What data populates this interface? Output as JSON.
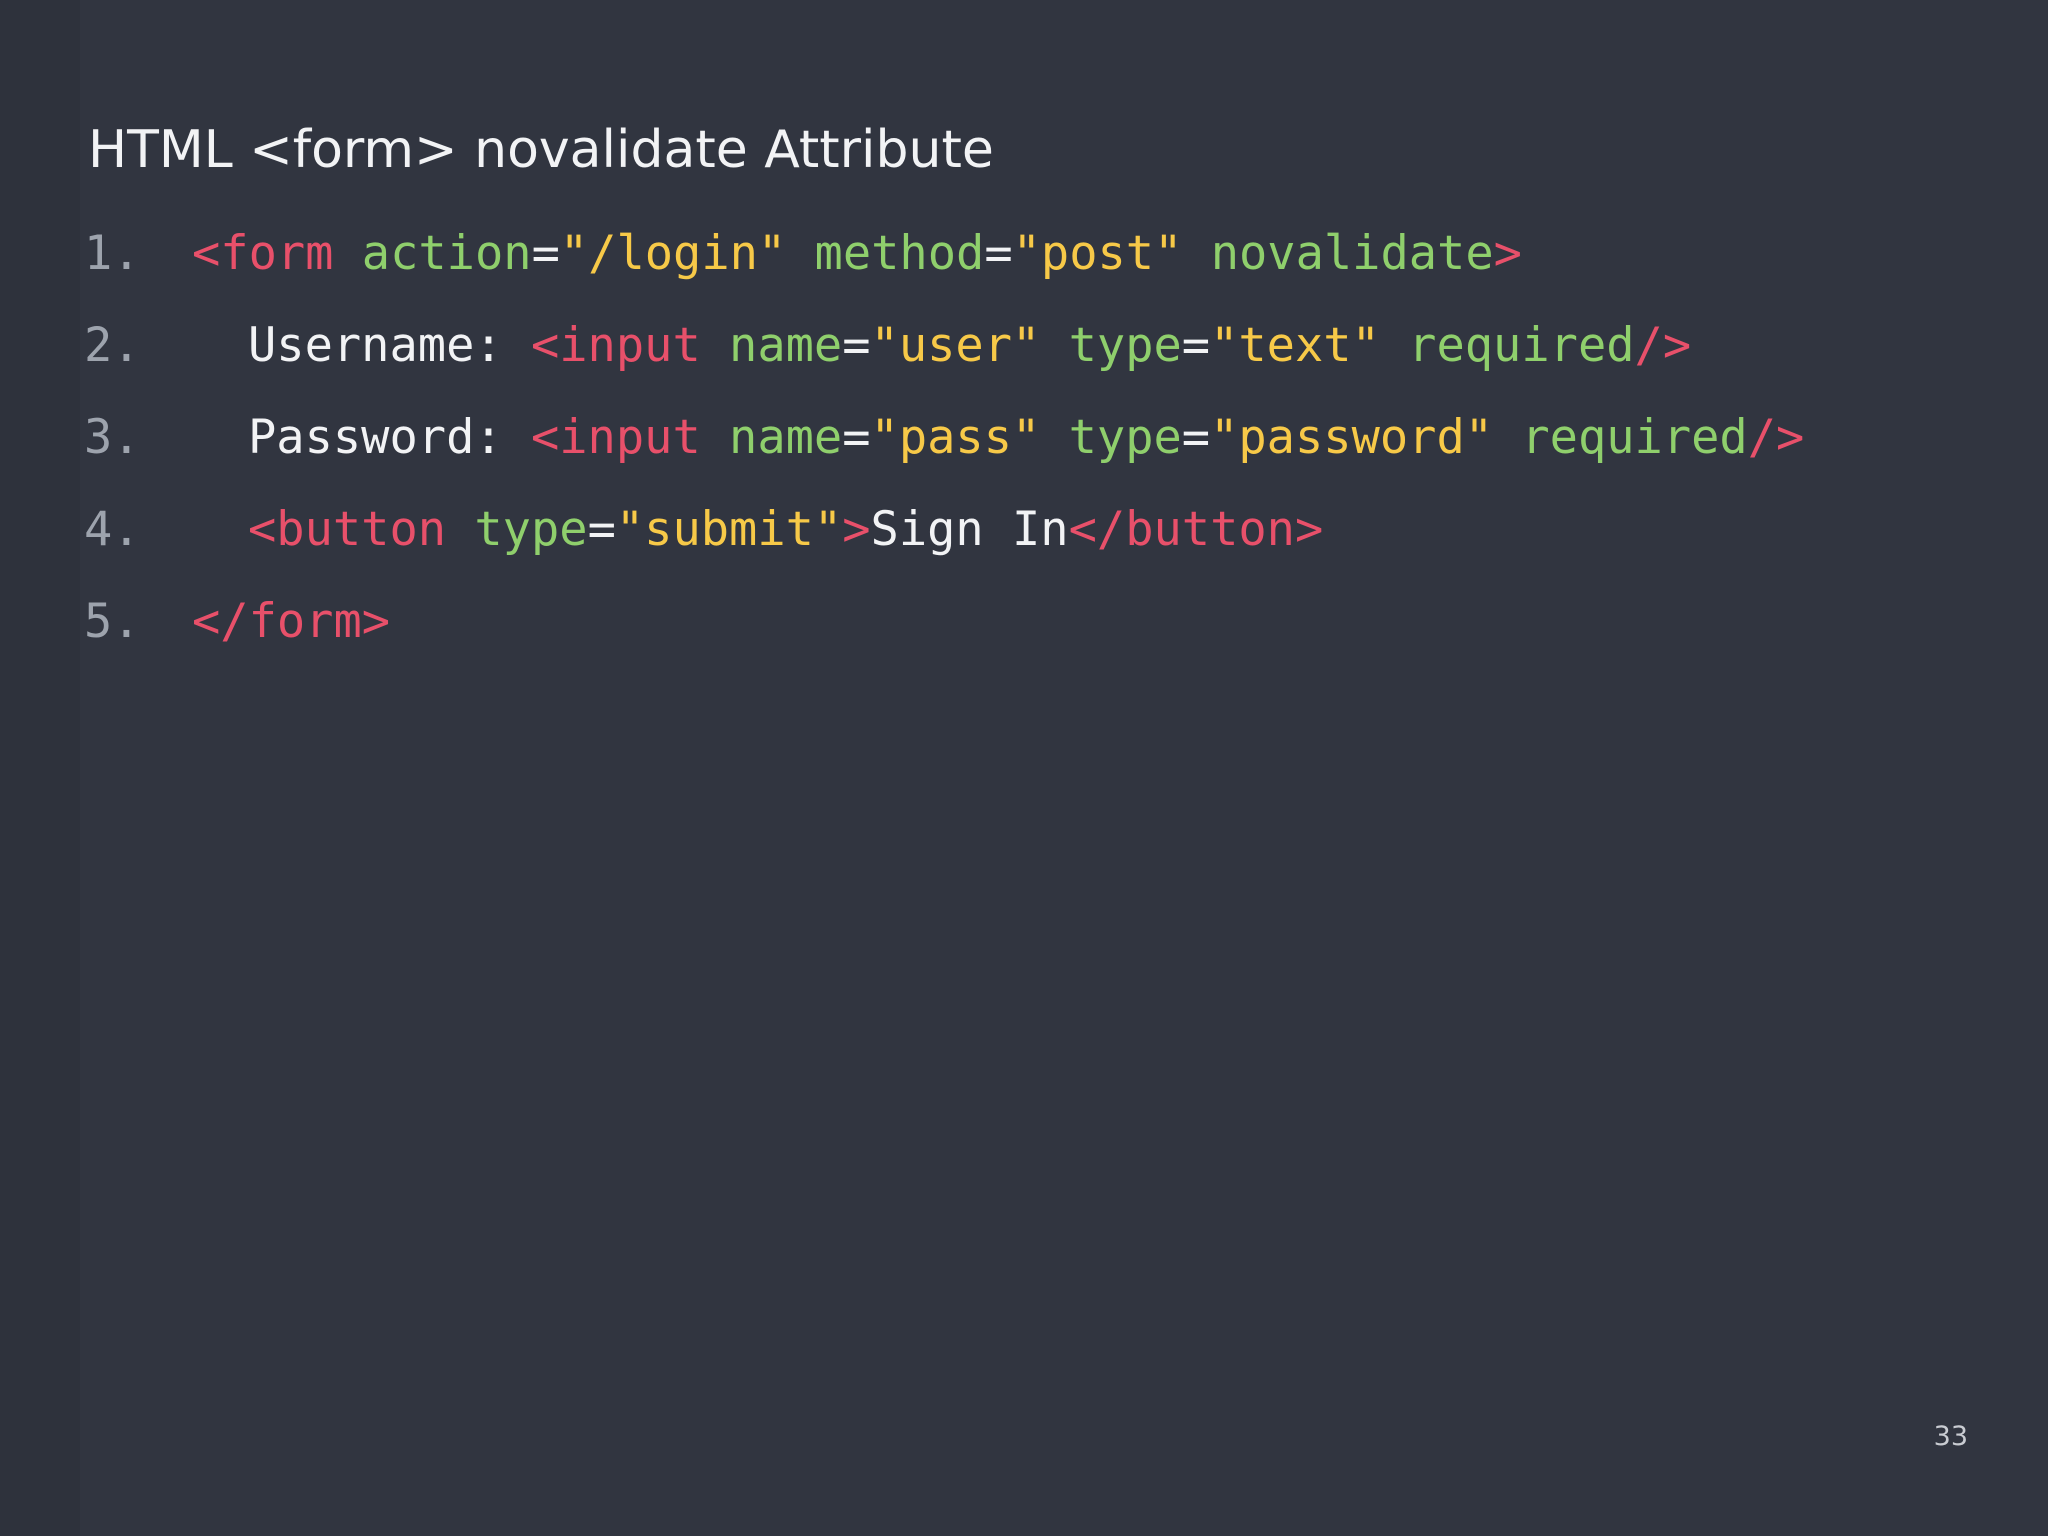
{
  "slide": {
    "title": "HTML <form> novalidate Attribute",
    "page_number": "33"
  },
  "code": {
    "lines": [
      {
        "number": "1.",
        "tokens": [
          "<form",
          " ",
          "action",
          "=",
          "\"/login\"",
          " ",
          "method",
          "=",
          "\"post\"",
          " ",
          "novalidate",
          ">"
        ]
      },
      {
        "number": "2.",
        "tokens": [
          "Username: ",
          "<input",
          " ",
          "name",
          "=",
          "\"user\"",
          " ",
          "type",
          "=",
          "\"text\"",
          " ",
          "required",
          "/>"
        ]
      },
      {
        "number": "3.",
        "tokens": [
          "Password: ",
          "<input",
          " ",
          "name",
          "=",
          "\"pass\"",
          " ",
          "type",
          "=",
          "\"password\"",
          " ",
          "required",
          "/>"
        ]
      },
      {
        "number": "4.",
        "tokens": [
          "<button",
          " ",
          "type",
          "=",
          "\"submit\"",
          ">",
          "Sign In",
          "</button>"
        ]
      },
      {
        "number": "5.",
        "tokens": [
          "</form>"
        ]
      }
    ]
  },
  "colors": {
    "background": "#313540",
    "tag": "#e8506a",
    "attribute": "#8fcf6c",
    "string": "#f7c948",
    "text": "#f2f3f5",
    "line_number": "#9da3ad"
  }
}
